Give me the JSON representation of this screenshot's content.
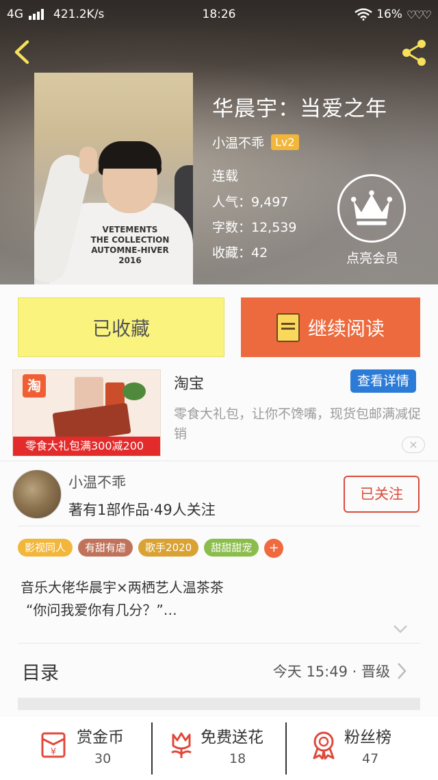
{
  "status_bar": {
    "network": "4G",
    "speed": "421.2K/s",
    "time": "18:26",
    "battery": "16%"
  },
  "book": {
    "title": "华晨宇：当爱之年",
    "author": "小温不乖",
    "level": "Lv2",
    "status": "连载",
    "popularity": "人气：9,497",
    "word_count": "字数：12,539",
    "favorites": "收藏：42",
    "cover_text": "VETEMENTS\nTHE COLLECTION\nAUTOMNE-HIVER 2016",
    "vip_label": "点亮会员"
  },
  "actions": {
    "favorited_label": "已收藏",
    "continue_label": "继续阅读"
  },
  "ad": {
    "source": "淘宝",
    "detail_button": "查看详情",
    "description": "零食大礼包，让你不馋嘴，现货包邮满减促销",
    "image_badge": "淘",
    "image_strip": "零食大礼包满300减200",
    "close": "×"
  },
  "author_card": {
    "name": "小温不乖",
    "stats": "著有1部作品·49人关注",
    "follow_label": "已关注"
  },
  "tags": [
    {
      "label": "影视同人",
      "color": "#f2b63a"
    },
    {
      "label": "有甜有虐",
      "color": "#c0735a"
    },
    {
      "label": "歌手2020",
      "color": "#d9a233"
    },
    {
      "label": "甜甜甜宠",
      "color": "#8bbd4c"
    }
  ],
  "tag_add": "+",
  "description": {
    "line1": "音乐大佬华晨宇×两栖艺人温茶茶",
    "line2": "“你问我爱你有几分？”…"
  },
  "toc": {
    "label": "目录",
    "update_info": "今天 15:49 · 晋级"
  },
  "bottom_bar": {
    "reward": {
      "label": "赏金币",
      "count": "30"
    },
    "flowers": {
      "label": "免费送花",
      "count": "18"
    },
    "fans": {
      "label": "粉丝榜",
      "count": "47"
    }
  },
  "colors": {
    "accent_orange": "#ec6a3d",
    "fav_yellow": "#faf47f",
    "follow_red": "#d94b3a",
    "detail_blue": "#2c7bd7"
  }
}
